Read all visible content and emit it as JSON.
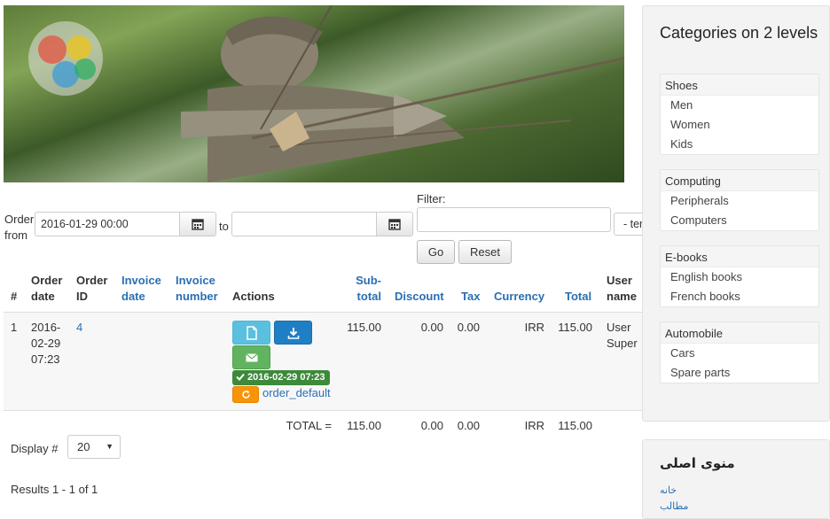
{
  "filters": {
    "order_from_label": "Order from",
    "from_value": "2016-01-29 00:00",
    "to_label": "to",
    "to_value": "",
    "filter_label": "Filter:",
    "filter_value": "",
    "select_partial": "- ter",
    "go_label": "Go",
    "reset_label": "Reset"
  },
  "table": {
    "headers": {
      "num": "#",
      "order_date": "Order date",
      "order_id": "Order ID",
      "invoice_date": "Invoice date",
      "invoice_number": "Invoice number",
      "actions": "Actions",
      "subtotal": "Sub-total",
      "discount": "Discount",
      "tax": "Tax",
      "currency": "Currency",
      "total": "Total",
      "user_name": "User name"
    },
    "row": {
      "num": "1",
      "order_date": "2016-02-29 07:23",
      "order_date_l1": "2016-",
      "order_date_l2": "02-29",
      "order_date_l3": "07:23",
      "order_id": "4",
      "invoice_date": "",
      "invoice_number": "",
      "date_badge": "2016-02-29 07:23",
      "template_link": "order_default",
      "subtotal": "115.00",
      "discount": "0.00",
      "tax": "0.00",
      "currency": "IRR",
      "total": "115.00",
      "user_l1": "User",
      "user_l2": "Super"
    },
    "totals": {
      "label": "TOTAL =",
      "subtotal": "115.00",
      "discount": "0.00",
      "tax": "0.00",
      "currency": "IRR",
      "total": "115.00"
    }
  },
  "pagination": {
    "display_label": "Display #",
    "display_value": "20",
    "results": "Results 1 - 1 of 1"
  },
  "sidebar": {
    "title": "Categories on 2 levels",
    "categories": [
      {
        "name": "Shoes",
        "items": [
          "Men",
          "Women",
          "Kids"
        ]
      },
      {
        "name": "Computing",
        "items": [
          "Peripherals",
          "Computers"
        ]
      },
      {
        "name": "E-books",
        "items": [
          "English books",
          "French books"
        ]
      },
      {
        "name": "Automobile",
        "items": [
          "Cars",
          "Spare parts"
        ]
      }
    ],
    "menu_title": "منوی اصلی",
    "menu_items": [
      "خانه",
      "مطالب"
    ]
  },
  "icons": {
    "calendar": "calendar-icon",
    "document": "document-icon",
    "download": "download-icon",
    "envelope": "envelope-icon",
    "check": "check-icon",
    "refresh": "refresh-icon",
    "caret": "caret-down-icon"
  },
  "colors": {
    "link": "#2a6fb4",
    "cyan_button": "#5bc0de",
    "blue_button": "#1f7fc4",
    "green_button": "#62b35f",
    "badge_green": "#3d8a3a",
    "orange_button": "#f89406"
  }
}
